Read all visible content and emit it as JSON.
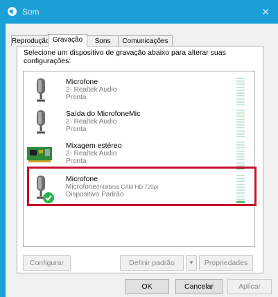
{
  "window": {
    "title": "Som"
  },
  "tabs": [
    {
      "label": "Reprodução",
      "active": false
    },
    {
      "label": "Gravação",
      "active": true
    },
    {
      "label": "Sons",
      "active": false
    },
    {
      "label": "Comunicações",
      "active": false
    }
  ],
  "instruction": "Selecione um dispositivo de gravação abaixo para alterar suas configurações:",
  "devices": [
    {
      "name": "Microfone",
      "line2": "2- Realtek Audio",
      "line2_suffix": "",
      "line3": "Pronta",
      "icon": "microphone-icon",
      "level": 0
    },
    {
      "name": "Saída do MicrofoneMic",
      "line2": "2- Realtek Audio",
      "line2_suffix": "",
      "line3": "Pronta",
      "icon": "microphone-icon",
      "level": 0
    },
    {
      "name": "Mixagem estéreo",
      "line2": "2- Realtek Audio",
      "line2_suffix": "",
      "line3": "Pronta",
      "icon": "sound-card-icon",
      "level": 1
    },
    {
      "name": "Microfone",
      "line2": "Microfone",
      "line2_suffix": "(Intelbras CAM HD 720p)",
      "line3": "Dispositivo Padrão",
      "icon": "microphone-default-icon",
      "level": 1,
      "highlighted": true
    }
  ],
  "buttons": {
    "configure": "Configurar",
    "set_default": "Definir padrão",
    "properties": "Propriedades",
    "ok": "OK",
    "cancel": "Cancelar",
    "apply": "Aplicar"
  },
  "colors": {
    "titlebar": "#1a9fd6",
    "highlight": "#c8102e",
    "meter_on": "#2bb24c"
  }
}
